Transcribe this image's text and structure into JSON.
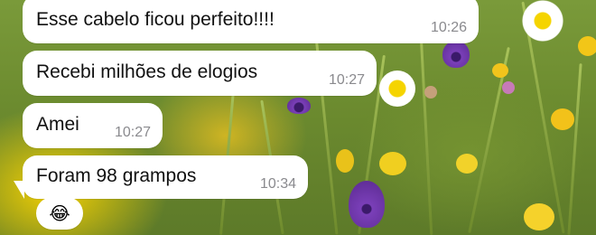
{
  "messages": [
    {
      "text": "Esse cabelo ficou perfeito!!!!",
      "time": "10:26"
    },
    {
      "text": "Recebi milhões de elogios",
      "time": "10:27"
    },
    {
      "text": "Amei",
      "time": "10:27"
    },
    {
      "text": "Foram 98 grampos",
      "time": "10:34"
    }
  ],
  "reaction": {
    "emoji": "😂"
  },
  "colors": {
    "bubble": "#ffffff",
    "timestamp": "#8a8a8e",
    "wallpaper_daisy_center": "#f5d400",
    "wallpaper_flower_purple": "#7a3fb8"
  }
}
